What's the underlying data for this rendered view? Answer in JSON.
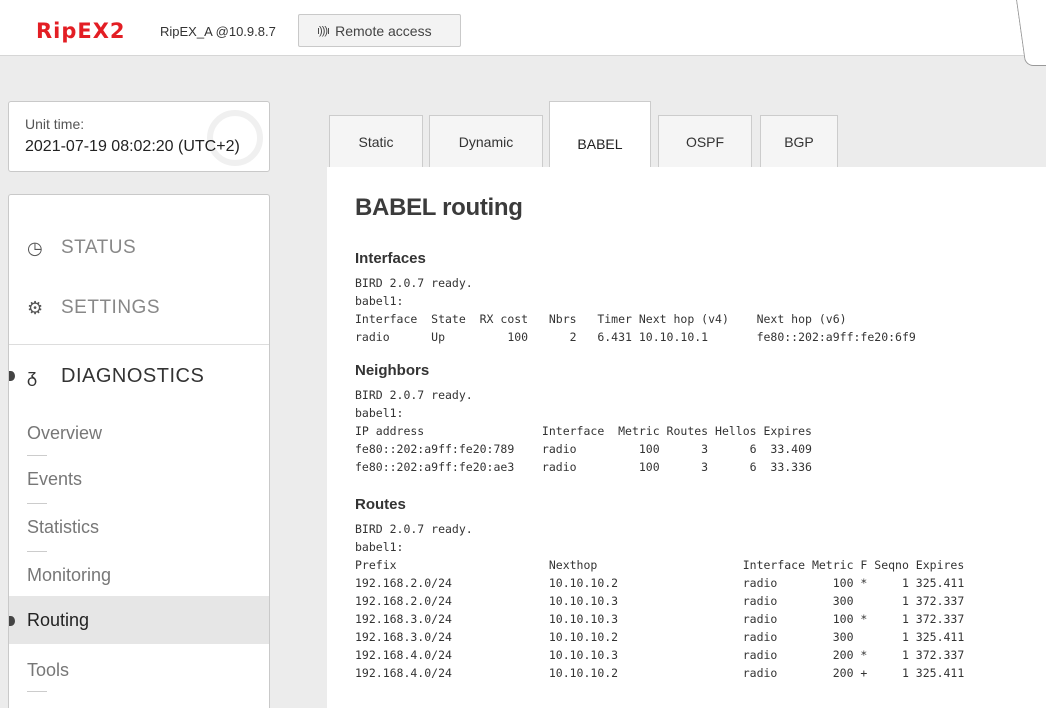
{
  "header": {
    "logo": "RipEX2",
    "unit_name": "RipEX_A @10.9.8.7",
    "remote_access_icon": "antenna-icon",
    "remote_access_label": "Remote access"
  },
  "unit_time": {
    "label": "Unit time:",
    "value": "2021-07-19 08:02:20 (UTC+2)"
  },
  "sidebar": {
    "status": {
      "icon": "gauge-icon",
      "label": "STATUS"
    },
    "settings": {
      "icon": "gears-icon",
      "label": "SETTINGS"
    },
    "diagnostics": {
      "icon": "stethoscope-icon",
      "label": "DIAGNOSTICS"
    },
    "items": [
      {
        "label": "Overview"
      },
      {
        "label": "Events"
      },
      {
        "label": "Statistics"
      },
      {
        "label": "Monitoring"
      },
      {
        "label": "Routing",
        "active": true
      },
      {
        "label": "Tools"
      }
    ]
  },
  "tabs": [
    {
      "label": "Static"
    },
    {
      "label": "Dynamic"
    },
    {
      "label": "BABEL",
      "active": true
    },
    {
      "label": "OSPF"
    },
    {
      "label": "BGP"
    }
  ],
  "main": {
    "title": "BABEL routing",
    "interfaces": {
      "heading": "Interfaces",
      "lines": [
        "BIRD 2.0.7 ready.",
        "babel1:",
        "Interface  State  RX cost   Nbrs   Timer Next hop (v4)    Next hop (v6)",
        "radio      Up         100      2   6.431 10.10.10.1       fe80::202:a9ff:fe20:6f9"
      ]
    },
    "neighbors": {
      "heading": "Neighbors",
      "lines": [
        "BIRD 2.0.7 ready.",
        "babel1:",
        "IP address                 Interface  Metric Routes Hellos Expires",
        "fe80::202:a9ff:fe20:789    radio         100      3      6  33.409",
        "fe80::202:a9ff:fe20:ae3    radio         100      3      6  33.336"
      ]
    },
    "routes": {
      "heading": "Routes",
      "lines": [
        "BIRD 2.0.7 ready.",
        "babel1:",
        "Prefix                      Nexthop                     Interface Metric F Seqno Expires",
        "192.168.2.0/24              10.10.10.2                  radio        100 *     1 325.411",
        "192.168.2.0/24              10.10.10.3                  radio        300       1 372.337",
        "192.168.3.0/24              10.10.10.3                  radio        100 *     1 372.337",
        "192.168.3.0/24              10.10.10.2                  radio        300       1 325.411",
        "192.168.4.0/24              10.10.10.3                  radio        200 *     1 372.337",
        "192.168.4.0/24              10.10.10.2                  radio        200 +     1 325.411"
      ]
    }
  }
}
